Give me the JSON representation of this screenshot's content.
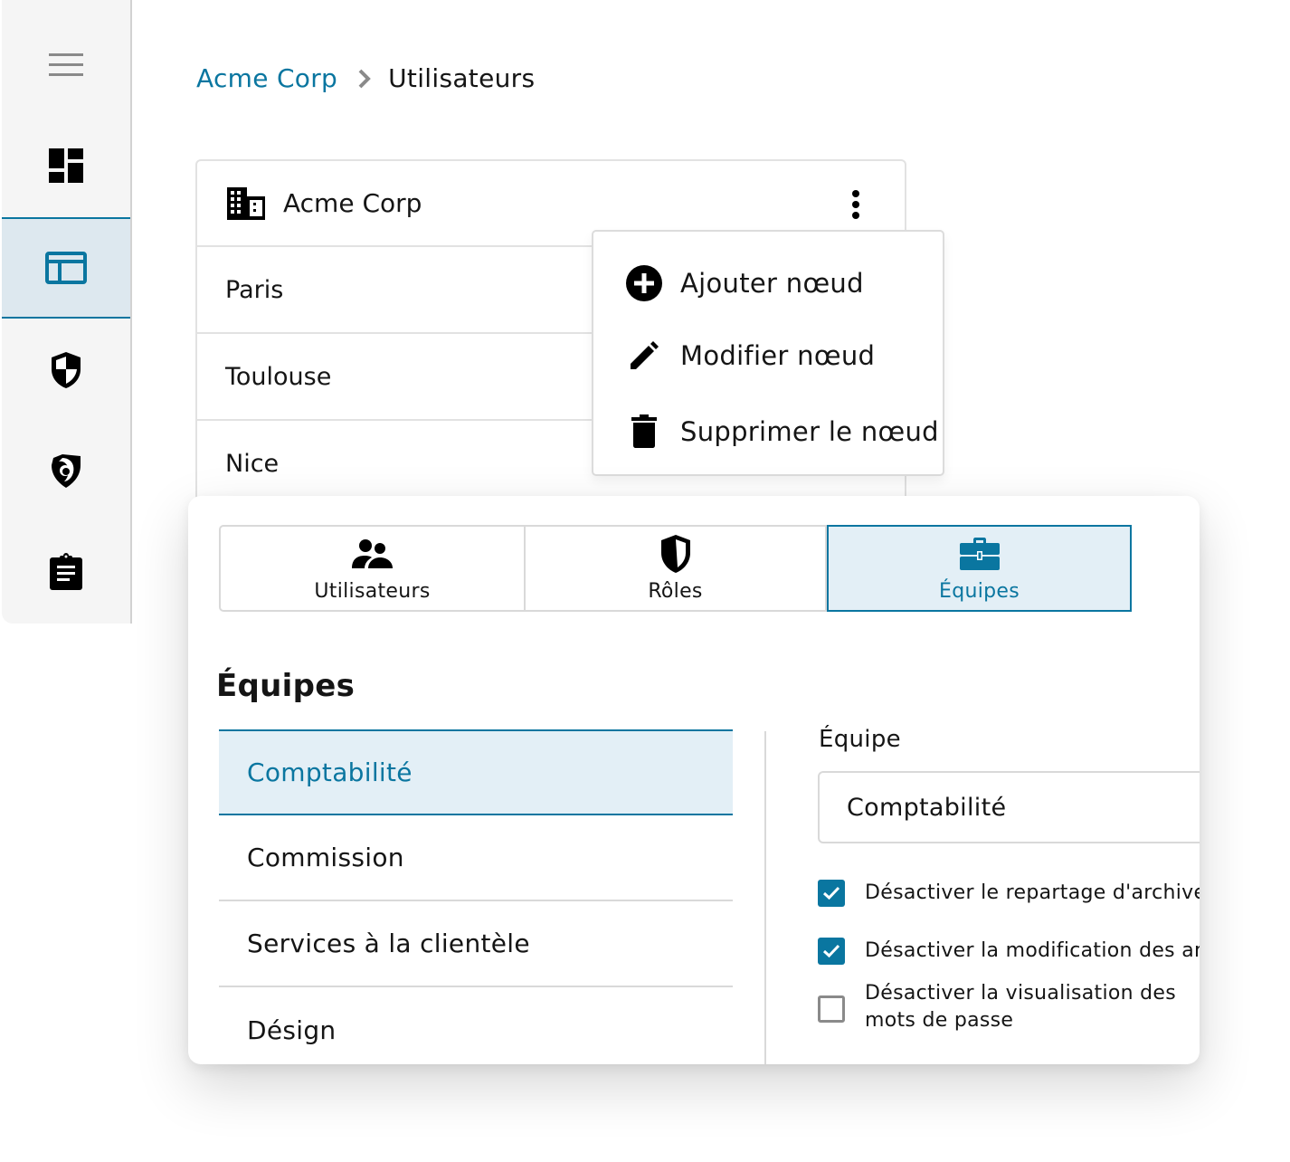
{
  "sidebar": {
    "items": [
      {
        "name": "menu",
        "icon": "hamburger-icon",
        "active": false
      },
      {
        "name": "dashboard",
        "icon": "dashboard-icon",
        "active": false
      },
      {
        "name": "layout",
        "icon": "layout-icon",
        "active": true
      },
      {
        "name": "security",
        "icon": "shield-icon",
        "active": false
      },
      {
        "name": "monitoring",
        "icon": "eye-shield-icon",
        "active": false
      },
      {
        "name": "reports",
        "icon": "clipboard-icon",
        "active": false
      }
    ]
  },
  "breadcrumb": {
    "parent": "Acme Corp",
    "current": "Utilisateurs"
  },
  "tree": {
    "root": "Acme Corp",
    "rows": [
      "Paris",
      "Toulouse",
      "Nice"
    ]
  },
  "context_menu": {
    "items": [
      {
        "label": "Ajouter nœud",
        "icon": "add-circle-icon"
      },
      {
        "label": "Modifier nœud",
        "icon": "pencil-icon"
      },
      {
        "label": "Supprimer le nœud",
        "icon": "trash-icon"
      }
    ]
  },
  "tabs": [
    {
      "label": "Utilisateurs",
      "icon": "users-icon",
      "active": false
    },
    {
      "label": "Rôles",
      "icon": "shield-half-icon",
      "active": false
    },
    {
      "label": "Équipes",
      "icon": "toolbox-icon",
      "active": true
    }
  ],
  "teams": {
    "title": "Équipes",
    "items": [
      {
        "label": "Comptabilité",
        "active": true
      },
      {
        "label": "Commission",
        "active": false
      },
      {
        "label": "Services à la clientèle",
        "active": false
      },
      {
        "label": "Désign",
        "active": false
      }
    ]
  },
  "detail": {
    "field_label": "Équipe",
    "field_value": "Comptabilité",
    "options": [
      {
        "label": "Désactiver le repartage d'archives",
        "checked": true
      },
      {
        "label": "Désactiver la modification des archives",
        "checked": true
      },
      {
        "label": "Désactiver la visualisation des mots de passe",
        "checked": false
      }
    ]
  },
  "colors": {
    "accent": "#0a76a0",
    "active_bg": "#e3eff6",
    "sidebar_bg": "#f5f5f5",
    "border": "#d9d9d9"
  }
}
